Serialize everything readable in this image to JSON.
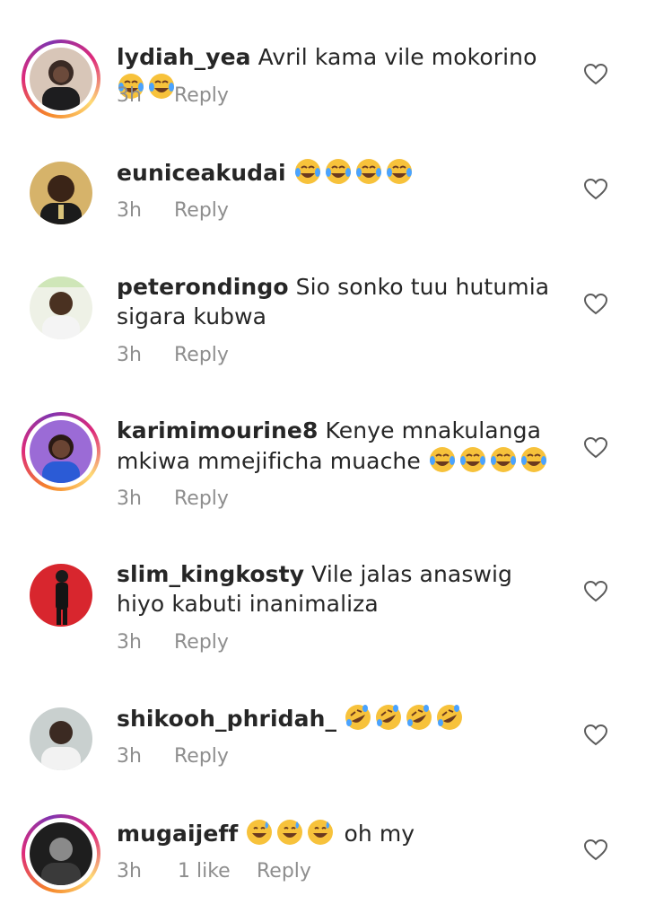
{
  "comments": [
    {
      "username": "lydiah_yea",
      "text": "Avril kama vile mokorino",
      "emojis": [
        "face-with-tears-of-joy",
        "face-with-tears-of-joy"
      ],
      "time": "3h",
      "reply": "Reply",
      "likes": ""
    },
    {
      "username": "euniceakudai",
      "text": "",
      "emojis": [
        "face-with-tears-of-joy",
        "face-with-tears-of-joy",
        "face-with-tears-of-joy",
        "face-with-tears-of-joy"
      ],
      "time": "3h",
      "reply": "Reply",
      "likes": ""
    },
    {
      "username": "peterondingo",
      "text": "Sio sonko tuu hutumia sigara kubwa",
      "emojis": [],
      "time": "3h",
      "reply": "Reply",
      "likes": ""
    },
    {
      "username": "karimimourine8",
      "text": "Kenye mnakulanga mkiwa mmejificha muache",
      "emojis": [
        "face-with-tears-of-joy",
        "face-with-tears-of-joy",
        "face-with-tears-of-joy",
        "face-with-tears-of-joy"
      ],
      "time": "3h",
      "reply": "Reply",
      "likes": ""
    },
    {
      "username": "slim_kingkosty",
      "text": "Vile jalas anaswig hiyo kabuti inanimaliza",
      "emojis": [],
      "time": "3h",
      "reply": "Reply",
      "likes": ""
    },
    {
      "username": "shikooh_phridah_",
      "text": "",
      "emojis": [
        "rolling-on-floor-laughing",
        "rolling-on-floor-laughing",
        "rolling-on-floor-laughing",
        "rolling-on-floor-laughing"
      ],
      "time": "3h",
      "reply": "Reply",
      "likes": ""
    },
    {
      "username": "mugaijeff",
      "text": "oh my",
      "emojis": [
        "grinning-face-with-sweat",
        "grinning-face-with-sweat",
        "grinning-face-with-sweat"
      ],
      "time": "3h",
      "reply": "Reply",
      "likes": "1 like"
    }
  ],
  "icons": {
    "heart": "heart-outline-icon"
  },
  "colors": {
    "text": "#262626",
    "meta": "#8e8e8e",
    "story_ring": "#dd2a7b"
  }
}
